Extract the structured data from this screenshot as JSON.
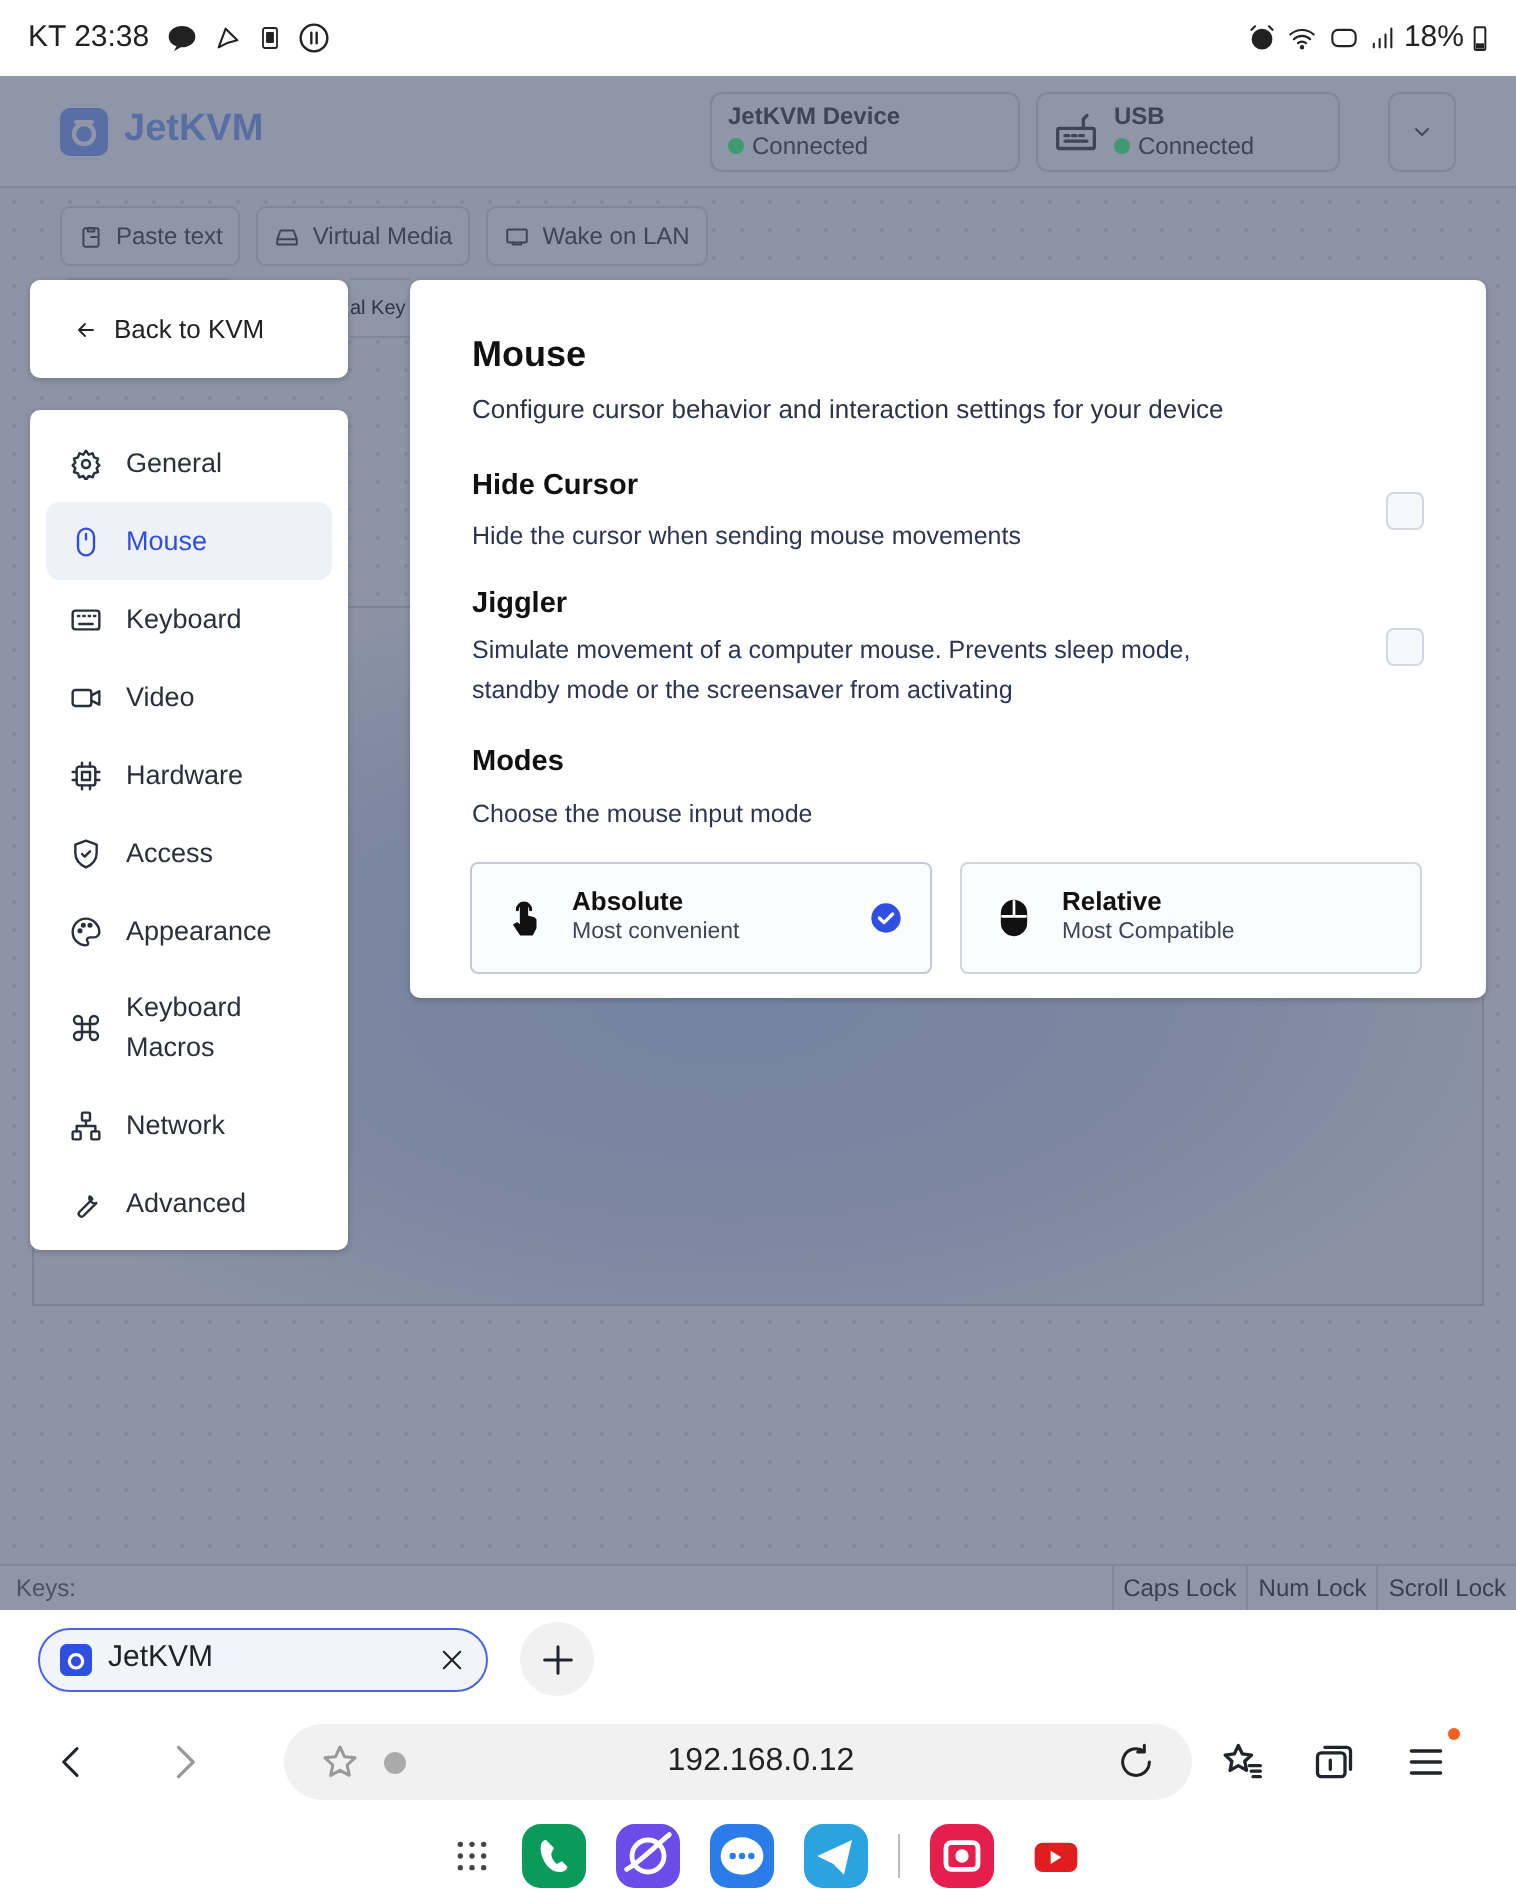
{
  "status_bar": {
    "carrier_time": "KT 23:38",
    "battery": "18%"
  },
  "app": {
    "logo": "JetKVM",
    "statuses": [
      {
        "title": "JetKVM Device",
        "state": "Connected"
      },
      {
        "title": "USB",
        "state": "Connected"
      }
    ],
    "toolbar": [
      "Paste text",
      "Virtual Media",
      "Wake on LAN"
    ],
    "toolbar_2": [
      "al Key"
    ],
    "footer": {
      "label": "Keys:",
      "locks": [
        "Caps Lock",
        "Num Lock",
        "Scroll Lock"
      ]
    }
  },
  "settings": {
    "back": "Back to KVM",
    "nav": [
      {
        "label": "General",
        "selected": false
      },
      {
        "label": "Mouse",
        "selected": true
      },
      {
        "label": "Keyboard",
        "selected": false
      },
      {
        "label": "Video",
        "selected": false
      },
      {
        "label": "Hardware",
        "selected": false
      },
      {
        "label": "Access",
        "selected": false
      },
      {
        "label": "Appearance",
        "selected": false
      },
      {
        "label": "Keyboard Macros",
        "selected": false
      },
      {
        "label": "Network",
        "selected": false
      },
      {
        "label": "Advanced",
        "selected": false
      }
    ],
    "title": "Mouse",
    "subtitle": "Configure cursor behavior and interaction settings for your device",
    "options": [
      {
        "title": "Hide Cursor",
        "description": "Hide the cursor when sending mouse movements",
        "checked": false
      },
      {
        "title": "Jiggler",
        "description": "Simulate movement of a computer mouse. Prevents sleep mode, standby mode or the screensaver from activating",
        "checked": false
      }
    ],
    "modes": {
      "title": "Modes",
      "description": "Choose the mouse input mode",
      "items": [
        {
          "label": "Absolute",
          "sub": "Most convenient",
          "selected": true
        },
        {
          "label": "Relative",
          "sub": "Most Compatible",
          "selected": false
        }
      ]
    }
  },
  "browser": {
    "tab": "JetKVM",
    "url": "192.168.0.12"
  }
}
